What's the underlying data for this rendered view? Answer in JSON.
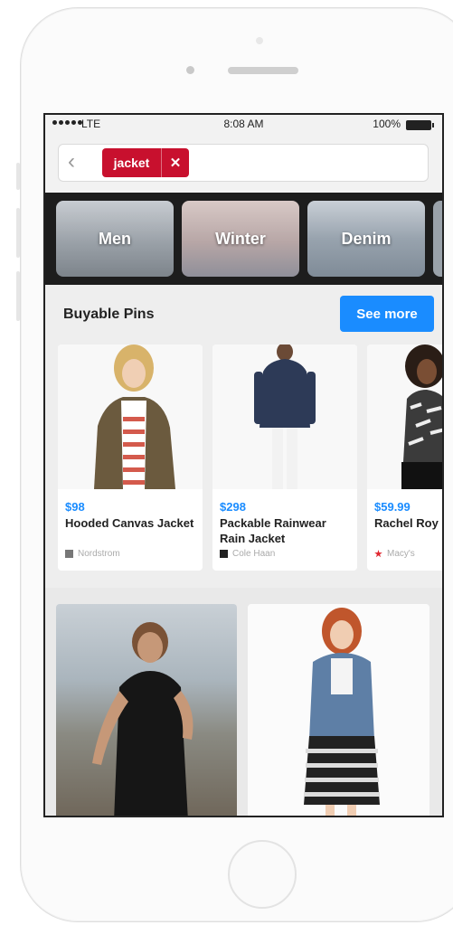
{
  "status": {
    "carrier": "LTE",
    "time": "8:08 AM",
    "battery": "100%"
  },
  "search": {
    "back_icon": "chevron-left-icon",
    "chip_label": "jacket",
    "chip_remove_icon": "close-icon",
    "chip_color": "#c8102e"
  },
  "guides": [
    {
      "label": "Men"
    },
    {
      "label": "Winter"
    },
    {
      "label": "Denim"
    }
  ],
  "buyable": {
    "title": "Buyable Pins",
    "see_more": "See more",
    "accent": "#1a8cff",
    "items": [
      {
        "price": "$98",
        "name": "Hooded Canvas Jacket",
        "store": "Nordstrom"
      },
      {
        "price": "$298",
        "name": "Packable Rainwear Rain Jacket",
        "store": "Cole Haan"
      },
      {
        "price": "$59.99",
        "name": "Rachel Roy Elbow-Slee",
        "store": "Macy's"
      }
    ]
  }
}
